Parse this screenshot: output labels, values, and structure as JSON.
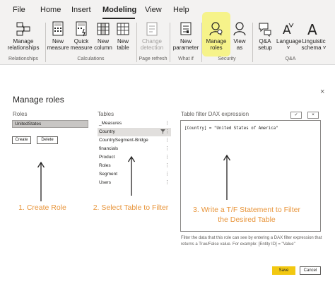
{
  "ribbon": {
    "tabs": [
      "File",
      "Home",
      "Insert",
      "Modeling",
      "View",
      "Help"
    ],
    "active_tab": "Modeling",
    "buttons": {
      "manage_relationships": [
        "Manage",
        "relationships"
      ],
      "new_measure": [
        "New",
        "measure"
      ],
      "quick_measure": [
        "Quick",
        "measure"
      ],
      "new_column": [
        "New",
        "column"
      ],
      "new_table": [
        "New",
        "table"
      ],
      "change_detection": [
        "Change",
        "detection"
      ],
      "new_parameter": [
        "New",
        "parameter"
      ],
      "manage_roles": [
        "Manage",
        "roles"
      ],
      "view_as": [
        "View",
        "as"
      ],
      "qa_setup": [
        "Q&A",
        "setup"
      ],
      "language": [
        "Language",
        "˅"
      ],
      "linguistic_schema": [
        "Linguistic",
        "schema ˅"
      ]
    },
    "groups": {
      "relationships": "Relationships",
      "calculations": "Calculations",
      "page_refresh": "Page refresh",
      "what_if": "What if",
      "security": "Security",
      "qa": "Q&A"
    }
  },
  "dialog": {
    "title": "Manage roles",
    "roles_header": "Roles",
    "tables_header": "Tables",
    "dax_header": "Table filter DAX expression",
    "selected_role": "UnitedStates",
    "create_label": "Create",
    "delete_label": "Delete",
    "tables": [
      "_Measures",
      "Country",
      "CountrySegment-Bridge",
      "financials",
      "Product",
      "Roles",
      "Segment",
      "Users"
    ],
    "selected_table": "Country",
    "dax_expression": "[Country] = \"United States of America\"",
    "check_label": "✓",
    "cancel_x_label": "×",
    "close_label": "×",
    "hint": "Filter the data that this role can see by entering a DAX filter expression that returns a True/False value. For example: [Entity ID] = \"Value\"",
    "save_label": "Save",
    "cancel_label": "Cancel"
  },
  "annotations": {
    "step1": "1. Create Role",
    "step2": "2. Select Table to Filter",
    "step3_line1": "3. Write a T/F Statement to Filter",
    "step3_line2": "the Desired Table",
    "color": "#e8953b"
  },
  "colors": {
    "highlight": "#f6f38a",
    "save_button": "#f2c811",
    "ribbon_bg": "#f3f2f1"
  }
}
